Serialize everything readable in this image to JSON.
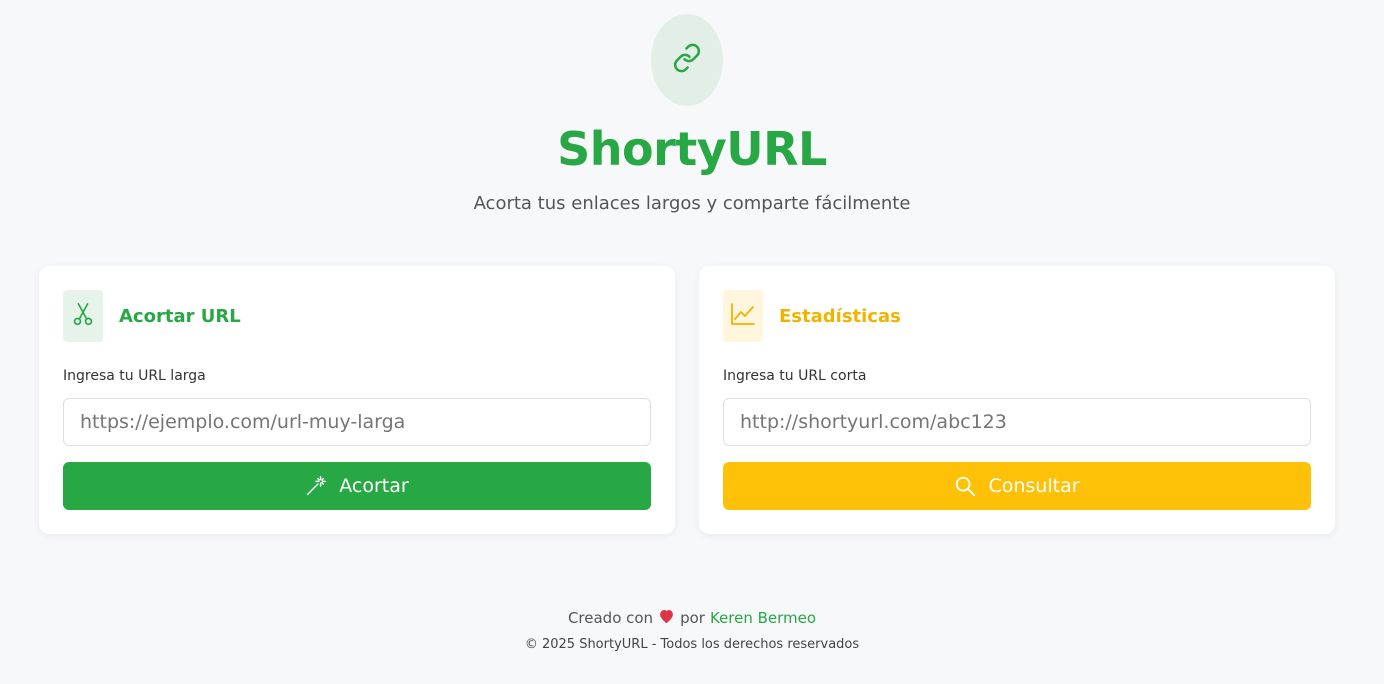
{
  "header": {
    "logo_icon": "link-icon",
    "brand": "ShortyURL",
    "tagline": "Acorta tus enlaces largos y comparte fácilmente"
  },
  "shorten_card": {
    "icon": "scissors-icon",
    "title": "Acortar URL",
    "label": "Ingresa tu URL larga",
    "input_placeholder": "https://ejemplo.com/url-muy-larga",
    "input_value": "",
    "button_icon": "magic-wand-icon",
    "button_label": "Acortar"
  },
  "stats_card": {
    "icon": "chart-line-icon",
    "title": "Estadísticas",
    "label": "Ingresa tu URL corta",
    "input_placeholder": "http://shortyurl.com/abc123",
    "input_value": "",
    "button_icon": "search-icon",
    "button_label": "Consultar"
  },
  "footer": {
    "created_with": "Creado con",
    "heart_icon": "heart-icon",
    "by": "por",
    "author": "Keren Bermeo",
    "copyright": "© 2025 ShortyURL - Todos los derechos reservados"
  },
  "colors": {
    "primary": "#28a745",
    "warning": "#ffc107",
    "heart": "#dc3545",
    "background": "#f7f8fa"
  }
}
